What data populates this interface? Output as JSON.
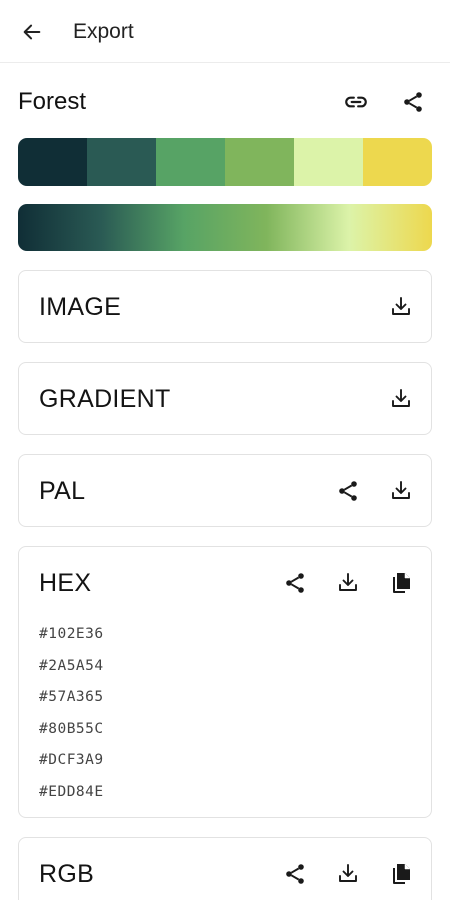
{
  "appbar": {
    "title": "Export",
    "back_icon": "arrow-left-icon"
  },
  "palette": {
    "name": "Forest",
    "colors": [
      "#102E36",
      "#2A5A54",
      "#57A365",
      "#80B55C",
      "#DCF3A9",
      "#EDD84E"
    ]
  },
  "export_cards": {
    "image": {
      "label": "IMAGE"
    },
    "gradient": {
      "label": "GRADIENT"
    },
    "pal": {
      "label": "PAL"
    },
    "hex": {
      "label": "HEX",
      "values": [
        "#102E36",
        "#2A5A54",
        "#57A365",
        "#80B55C",
        "#DCF3A9",
        "#EDD84E"
      ]
    },
    "rgb": {
      "label": "RGB"
    }
  },
  "icons": {
    "link": "link-icon",
    "share": "share-icon",
    "download": "download-icon",
    "copy": "copy-icon"
  }
}
